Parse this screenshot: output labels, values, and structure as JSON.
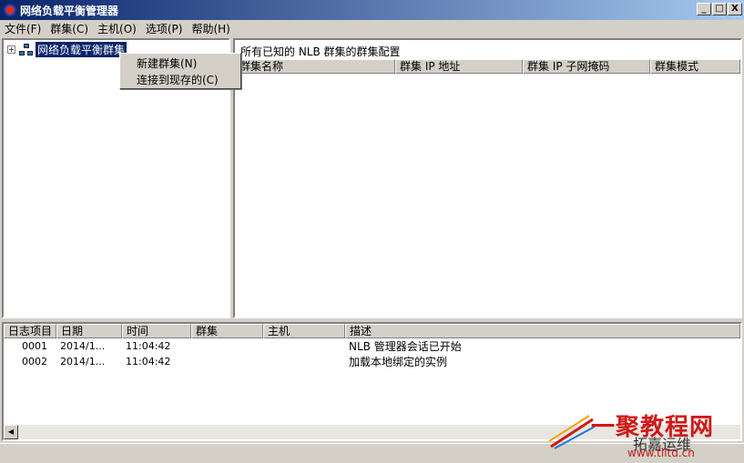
{
  "window": {
    "title": "网络负载平衡管理器",
    "controls": [
      "_",
      "□",
      "X"
    ]
  },
  "menu": [
    "文件(F)",
    "群集(C)",
    "主机(O)",
    "选项(P)",
    "帮助(H)"
  ],
  "tree": {
    "expander": "+",
    "root_label": "网络负载平衡群集"
  },
  "context_menu": [
    "新建群集(N)",
    "连接到现存的(C)"
  ],
  "right_pane": {
    "title": "所有已知的 NLB 群集的群集配置",
    "columns": [
      "群集名称",
      "群集 IP 地址",
      "群集 IP 子网掩码",
      "群集模式"
    ]
  },
  "log": {
    "columns": [
      "日志项目",
      "日期",
      "时间",
      "群集",
      "主机",
      "描述"
    ],
    "rows": [
      {
        "id": "0001",
        "date": "2014/1...",
        "time": "11:04:42",
        "cluster": "",
        "host": "",
        "desc": "NLB 管理器会话已开始"
      },
      {
        "id": "0002",
        "date": "2014/1...",
        "time": "11:04:42",
        "cluster": "",
        "host": "",
        "desc": "加载本地绑定的实例"
      }
    ]
  },
  "watermark": {
    "brand": "一聚教程网",
    "sub": "拓嘉运维",
    "url": "www.tlltd.cn"
  },
  "colors": {
    "titlebar": "#0a246a",
    "selection": "#0a246a",
    "watermark_red": "#d01818"
  }
}
